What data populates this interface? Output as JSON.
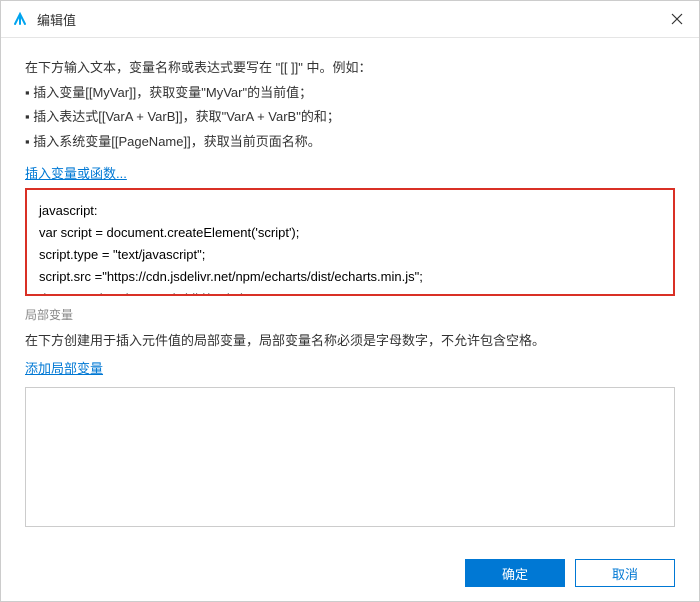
{
  "titlebar": {
    "title": "编辑值"
  },
  "intro": {
    "line1": "在下方输入文本，变量名称或表达式要写在 \"[[ ]]\" 中。例如：",
    "bullet1": "▪ 插入变量[[MyVar]]，获取变量\"MyVar\"的当前值；",
    "bullet2": "▪ 插入表达式[[VarA + VarB]]，获取\"VarA + VarB\"的和；",
    "bullet3": "▪ 插入系统变量[[PageName]]，获取当前页面名称。"
  },
  "insert_link": "插入变量或函数...",
  "code_value": "javascript:\nvar script = document.createElement('script');\nscript.type = \"text/javascript\";\nscript.src =\"https://cdn.jsdelivr.net/npm/echarts/dist/echarts.min.js\";\ndocument.head.appendChild(script);",
  "local_vars": {
    "label": "局部变量",
    "desc": "在下方创建用于插入元件值的局部变量，局部变量名称必须是字母数字，不允许包含空格。",
    "add_link": "添加局部变量"
  },
  "footer": {
    "ok": "确定",
    "cancel": "取消"
  }
}
